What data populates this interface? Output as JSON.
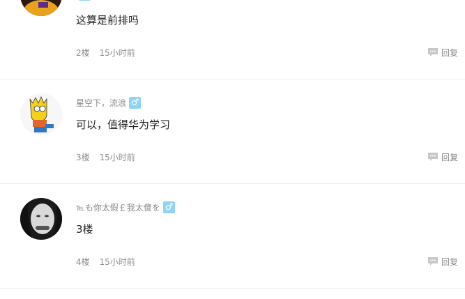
{
  "comments": [
    {
      "username": "",
      "gender_icon": "male-icon",
      "gender_symbol": "♂",
      "content": "这算是前排吗",
      "floor": "2楼",
      "time": "15小时前",
      "reply_label": "回复"
    },
    {
      "username": "星空下，流浪",
      "gender_icon": "male-icon",
      "gender_symbol": "♂",
      "content": "可以，值得华为学习",
      "floor": "3楼",
      "time": "15小时前",
      "reply_label": "回复"
    },
    {
      "username": "℡も你太假￡我太傻を",
      "gender_icon": "male-icon",
      "gender_symbol": "♂",
      "content": "3楼",
      "floor": "4楼",
      "time": "15小时前",
      "reply_label": "回复"
    }
  ],
  "colors": {
    "gender_badge": "#8fd3f6",
    "divider": "#ececec",
    "meta_text": "#8c8c8c"
  }
}
